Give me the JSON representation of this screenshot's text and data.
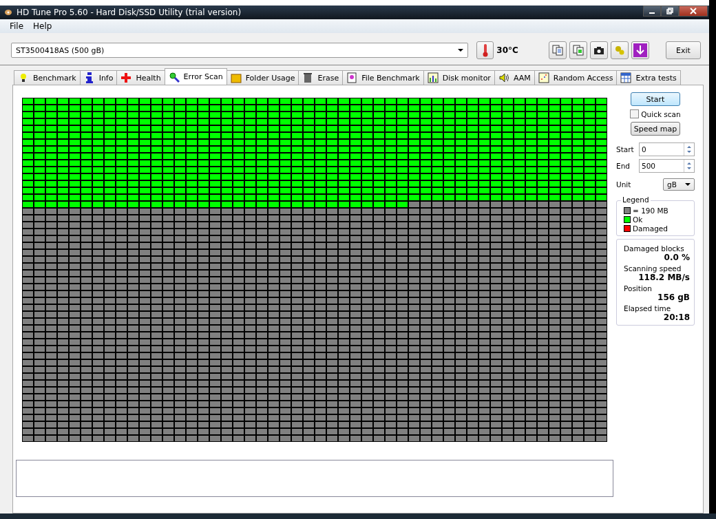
{
  "window": {
    "title": "HD Tune Pro 5.60 - Hard Disk/SSD Utility (trial version)"
  },
  "menu": [
    "File",
    "Help"
  ],
  "drive": {
    "value": "ST3500418AS (500 gB)"
  },
  "temperature": "30°C",
  "exit_button": "Exit",
  "tabs": [
    {
      "label": "Benchmark",
      "kind": "bulb",
      "selected": false
    },
    {
      "label": "Info",
      "kind": "info",
      "selected": false
    },
    {
      "label": "Health",
      "kind": "cross",
      "selected": false
    },
    {
      "label": "Error Scan",
      "kind": "magnifier",
      "selected": true
    },
    {
      "label": "Folder Usage",
      "kind": "folder",
      "selected": false
    },
    {
      "label": "Erase",
      "kind": "trash",
      "selected": false
    },
    {
      "label": "File Benchmark",
      "kind": "file",
      "selected": false
    },
    {
      "label": "Disk monitor",
      "kind": "chart",
      "selected": false
    },
    {
      "label": "AAM",
      "kind": "speaker",
      "selected": false
    },
    {
      "label": "Random Access",
      "kind": "scatter",
      "selected": false
    },
    {
      "label": "Extra tests",
      "kind": "table",
      "selected": false
    }
  ],
  "scan_map": {
    "level": 0.3132
  },
  "controls": {
    "start_button": "Start",
    "quick_scan": {
      "label": "Quick scan",
      "checked": false
    },
    "speed_map_button": "Speed map",
    "start": {
      "label": "Start",
      "value": "0"
    },
    "end": {
      "label": "End",
      "value": "500"
    },
    "unit": {
      "label": "Unit",
      "value": "gB"
    }
  },
  "legend": {
    "title": "Legend",
    "items": [
      {
        "label": "= 190 MB",
        "color": "#808080"
      },
      {
        "label": "Ok",
        "color": "#00ff00"
      },
      {
        "label": "Damaged",
        "color": "#ff0000"
      }
    ]
  },
  "stats": [
    {
      "label": "Damaged blocks",
      "value": "0.0 %"
    },
    {
      "label": "Scanning speed",
      "value": "118.2 MB/s"
    },
    {
      "label": "Position",
      "value": "156 gB"
    },
    {
      "label": "Elapsed time",
      "value": "20:18"
    }
  ]
}
